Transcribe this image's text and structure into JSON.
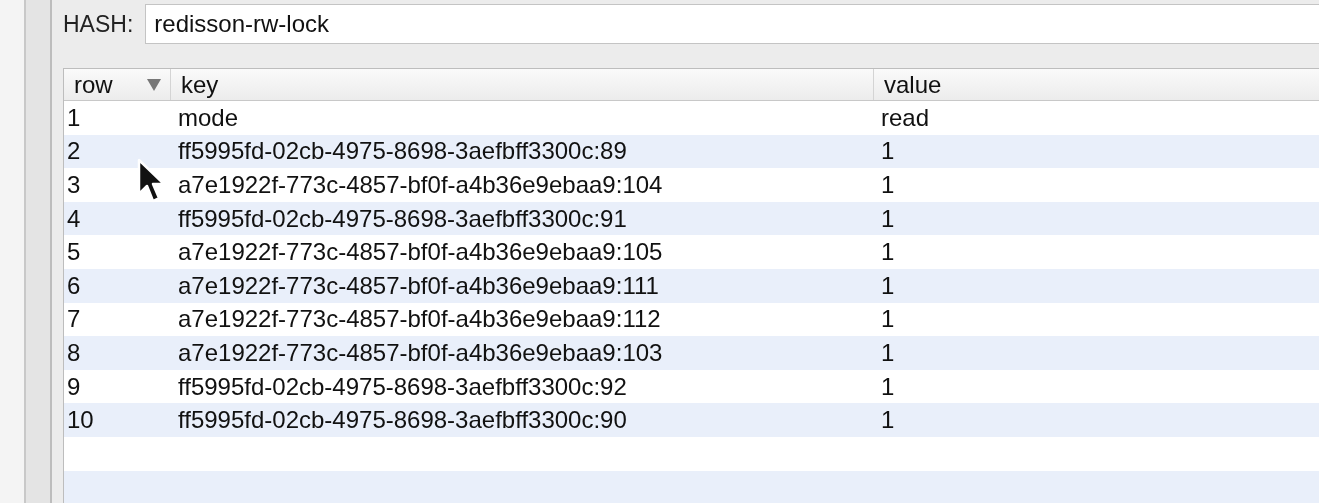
{
  "hash_field": {
    "label": "HASH:",
    "value": "redisson-rw-lock"
  },
  "table": {
    "columns": [
      "row",
      "key",
      "value"
    ],
    "rows": [
      {
        "row": "1",
        "key": "mode",
        "value": "read"
      },
      {
        "row": "2",
        "key": "ff5995fd-02cb-4975-8698-3aefbff3300c:89",
        "value": "1"
      },
      {
        "row": "3",
        "key": "a7e1922f-773c-4857-bf0f-a4b36e9ebaa9:104",
        "value": "1"
      },
      {
        "row": "4",
        "key": "ff5995fd-02cb-4975-8698-3aefbff3300c:91",
        "value": "1"
      },
      {
        "row": "5",
        "key": "a7e1922f-773c-4857-bf0f-a4b36e9ebaa9:105",
        "value": "1"
      },
      {
        "row": "6",
        "key": "a7e1922f-773c-4857-bf0f-a4b36e9ebaa9:111",
        "value": "1"
      },
      {
        "row": "7",
        "key": "a7e1922f-773c-4857-bf0f-a4b36e9ebaa9:112",
        "value": "1"
      },
      {
        "row": "8",
        "key": "a7e1922f-773c-4857-bf0f-a4b36e9ebaa9:103",
        "value": "1"
      },
      {
        "row": "9",
        "key": "ff5995fd-02cb-4975-8698-3aefbff3300c:92",
        "value": "1"
      },
      {
        "row": "10",
        "key": "ff5995fd-02cb-4975-8698-3aefbff3300c:90",
        "value": "1"
      }
    ]
  }
}
